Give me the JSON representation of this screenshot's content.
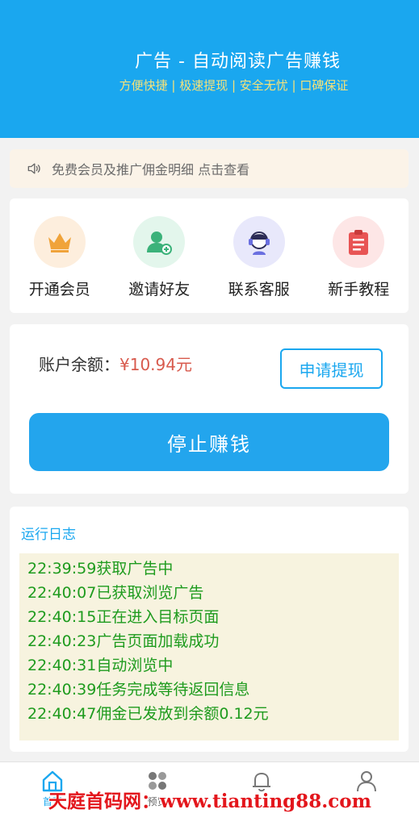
{
  "header": {
    "title": "广告 - 自动阅读广告赚钱",
    "subtitle": "方便快捷 | 极速提现 | 安全无忧 | 口碑保证"
  },
  "notice": {
    "text": "免费会员及推广佣金明细 点击查看",
    "icon": "speaker-icon"
  },
  "menu": [
    {
      "label": "开通会员",
      "icon": "crown-icon",
      "bg": "#fdeedd",
      "color": "#f0a33a"
    },
    {
      "label": "邀请好友",
      "icon": "add-user-icon",
      "bg": "#e3f6ec",
      "color": "#3bb27a"
    },
    {
      "label": "联系客服",
      "icon": "customer-service-icon",
      "bg": "#e8e8fb",
      "color": "#6a6fe0"
    },
    {
      "label": "新手教程",
      "icon": "clipboard-icon",
      "bg": "#fde6e6",
      "color": "#e85454"
    }
  ],
  "balance": {
    "label": "账户余额：",
    "amount": "¥10.94元",
    "withdraw_label": "申请提现",
    "stop_label": "停止赚钱"
  },
  "log": {
    "title": "运行日志",
    "lines": [
      "22:39:59获取广告中",
      "22:40:07已获取浏览广告",
      "22:40:15正在进入目标页面",
      "22:40:23广告页面加载成功",
      "22:40:31自动浏览中",
      "22:40:39任务完成等待返回信息",
      "22:40:47佣金已发放到余额0.12元"
    ]
  },
  "tabs": [
    {
      "label": "首页",
      "icon": "home-icon",
      "active": true
    },
    {
      "label": "预览",
      "icon": "apps-icon",
      "active": false
    },
    {
      "label": "",
      "icon": "bell-icon",
      "active": false
    },
    {
      "label": "",
      "icon": "user-icon",
      "active": false
    }
  ],
  "watermark": "天庭首码网：www.tianting88.com",
  "colors": {
    "primary": "#1aa7ef",
    "amount": "#d85a4d",
    "log_text": "#1e9b1e",
    "subtitle": "#f6e27a"
  }
}
